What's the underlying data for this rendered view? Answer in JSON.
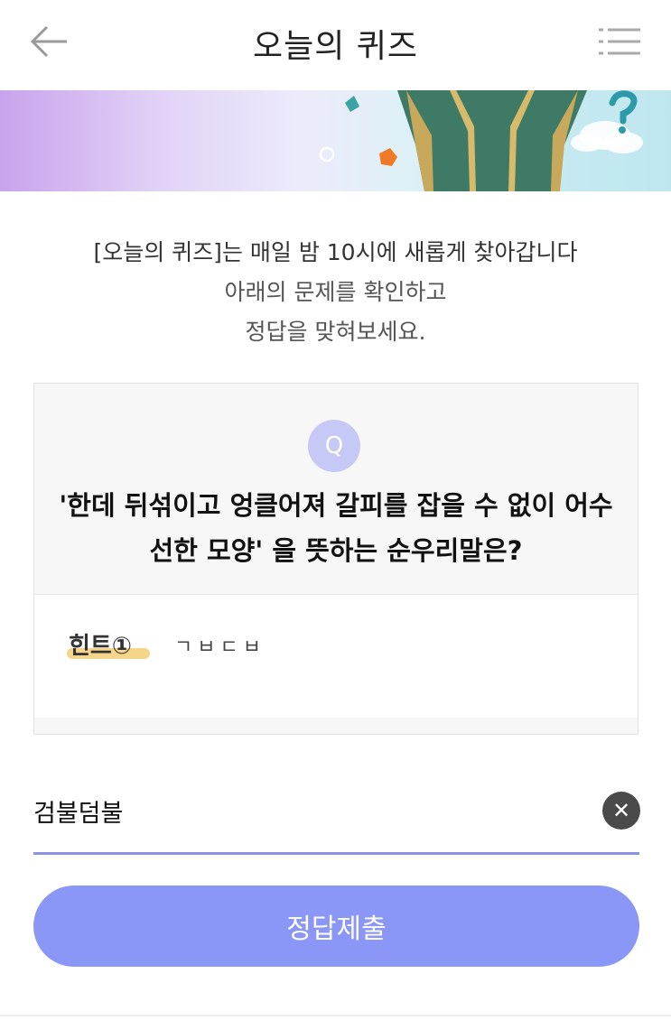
{
  "header": {
    "title": "오늘의 퀴즈",
    "back_icon": "arrow-left-icon",
    "menu_icon": "menu-icon"
  },
  "intro": {
    "line1": "[오늘의 퀴즈]는 매일 밤 10시에 새롭게 찾아갑니다",
    "line2": "아래의 문제를 확인하고",
    "line3": "정답을 맞혀보세요."
  },
  "quiz": {
    "badge": "Q",
    "question_line1": "'한데 뒤섞이고 엉클어져 갈피를 잡을 수 없이 어수",
    "question_line2": "선한 모양' 을 뜻하는 순우리말은?",
    "hint_label": "힌트①",
    "hint_value": "ㄱㅂㄷㅂ"
  },
  "answer": {
    "value": "검불덤불",
    "clear_icon": "close-icon"
  },
  "submit": {
    "label": "정답제출"
  },
  "colors": {
    "accent": "#8b97f7",
    "badge": "#c6c9f6",
    "hint_highlight": "#f5d58a",
    "underline": "#8b93e6"
  }
}
